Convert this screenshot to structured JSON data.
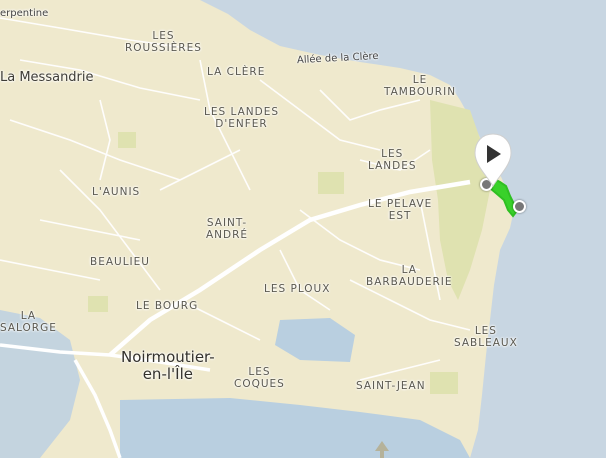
{
  "map": {
    "colors": {
      "land": "#efe9cd",
      "sea": "#c8d6e2",
      "road": "#ffffff",
      "park": "#dfe2b0",
      "harbour": "#b9cfe0",
      "route": "#39d12a"
    },
    "labels": {
      "serpentine": "erpentine",
      "les_roussieres": "LES\nROUSSIÈRES",
      "la_messandrie": "La Messandrie",
      "la_clere": "LA CLÈRE",
      "allee_de_la_clere": "Allée de la Clère",
      "le_tambourin": "LE\nTAMBOURIN",
      "les_landes_denfer": "LES LANDES\nD'ENFER",
      "les_landes": "LES\nLANDES",
      "launis": "L'AUNIS",
      "saint_andre": "SAINT-\nANDRÉ",
      "le_pelave_est": "LE PELAVE\nEST",
      "beaulieu": "BEAULIEU",
      "la_barbauderie": "LA\nBARBAUDERIE",
      "le_bourg": "LE BOURG",
      "les_ploux": "LES PLOUX",
      "la_salorge": "LA\nSALORGE",
      "les_sableaux": "LES\nSABLEAUX",
      "noirmoutier": "Noirmoutier-\nen-l'Île",
      "les_coques": "LES\nCOQUES",
      "saint_jean": "SAINT-JEAN"
    },
    "icons": {
      "play": "play-icon",
      "tree": "tree-icon"
    }
  }
}
